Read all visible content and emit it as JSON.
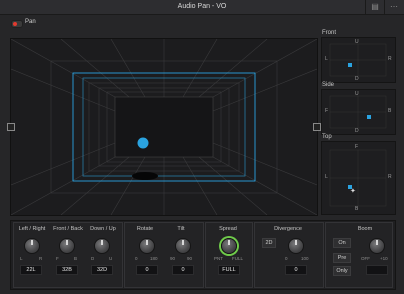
{
  "window": {
    "title": "Audio Pan - VO"
  },
  "toolbar": {
    "icon_a": "snapshot-icon",
    "icon_b": "more-icon"
  },
  "pan": {
    "label": "Pan",
    "enabled": true
  },
  "views": {
    "front": {
      "label": "Front",
      "top_letter": "U",
      "left_letter": "L",
      "right_letter": "R",
      "bottom_letter": "D"
    },
    "side": {
      "label": "Side",
      "top_letter": "U",
      "left_letter": "F",
      "right_letter": "B",
      "bottom_letter": "D"
    },
    "top": {
      "label": "Top",
      "top_letter": "F",
      "left_letter": "L",
      "right_letter": "R",
      "bottom_letter": "B"
    }
  },
  "controls": {
    "left_right": {
      "label": "Left / Right",
      "min": "L",
      "max": "R",
      "value": "22L"
    },
    "front_back": {
      "label": "Front / Back",
      "min": "F",
      "max": "B",
      "value": "32B"
    },
    "down_up": {
      "label": "Down / Up",
      "min": "D",
      "max": "U",
      "value": "32D"
    },
    "rotate": {
      "label": "Rotate",
      "min": "0",
      "max": "180",
      "value": "0"
    },
    "tilt": {
      "label": "Tilt",
      "min": "90",
      "max": "90",
      "value": "0"
    },
    "spread": {
      "label": "Spread",
      "min": "PNT",
      "max": "FULL",
      "value": "FULL"
    },
    "divergence": {
      "label": "Divergence",
      "mode": "2D",
      "min": "0",
      "max": "100",
      "value": "0"
    },
    "boom": {
      "label": "Boom",
      "on": "On",
      "pre": "Pre",
      "only": "Only",
      "min": "OFF",
      "max": "+10"
    }
  },
  "colors": {
    "accent": "#2aa3e0",
    "spread_ring": "#6fcb4a",
    "pan_led": "#e23a2f"
  }
}
